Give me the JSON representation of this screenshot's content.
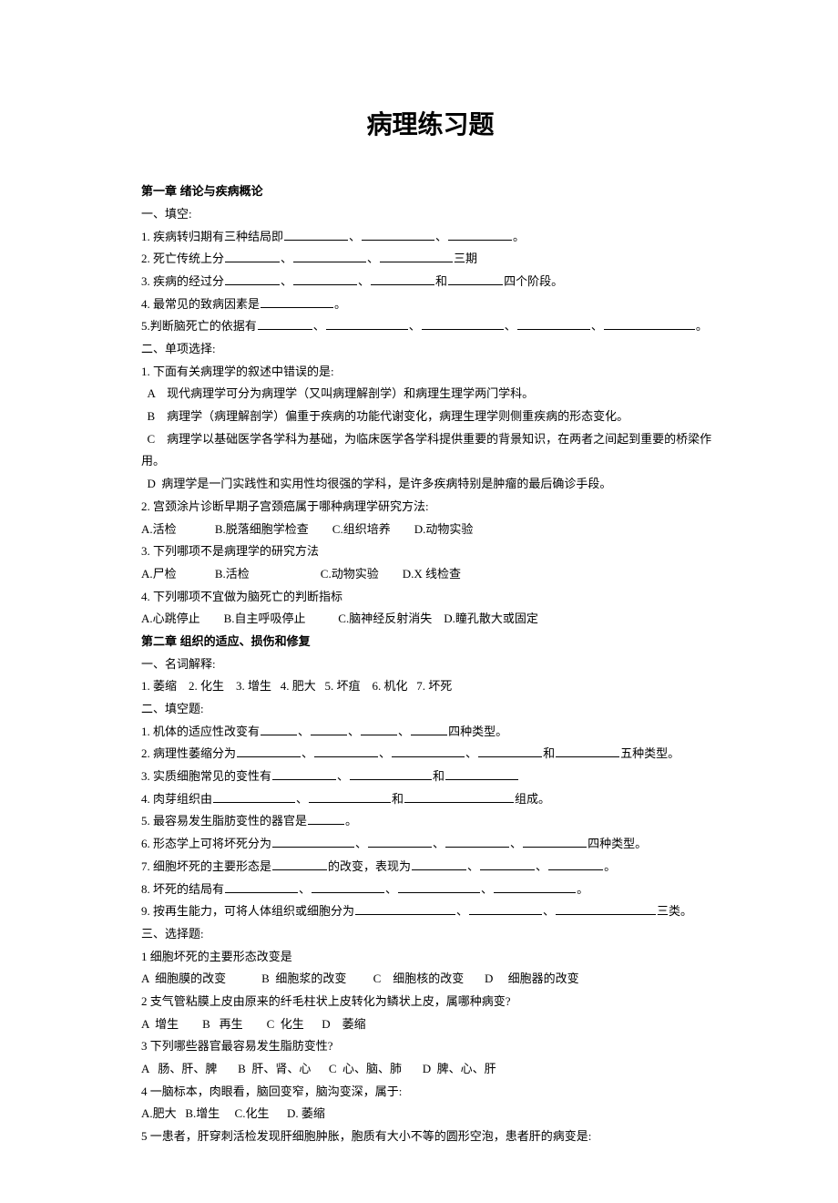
{
  "title": "病理练习题",
  "ch1": {
    "header": "第一章  绪论与疾病概论",
    "sec1_header": "一、填空:",
    "q1_a": "1. 疾病转归期有三种结局即",
    "q1_b": "、",
    "q1_c": "、",
    "q1_d": "。",
    "q2_a": "2. 死亡传统上分",
    "q2_b": "、",
    "q2_c": "、",
    "q2_d": "三期",
    "q3_a": "3. 疾病的经过分",
    "q3_b": "、",
    "q3_c": "、",
    "q3_d": "和",
    "q3_e": "四个阶段。",
    "q4_a": "4. 最常见的致病因素是",
    "q4_b": "。",
    "q5_a": "5.判断脑死亡的依据有",
    "q5_b": "、",
    "q5_c": "、",
    "q5_d": "、",
    "q5_e": "、",
    "q5_f": "。",
    "sec2_header": "二、单项选择:",
    "mc1": "1. 下面有关病理学的叙述中错误的是:",
    "mc1a": "  A    现代病理学可分为病理学（又叫病理解剖学）和病理生理学两门学科。",
    "mc1b": "  B    病理学（病理解剖学）偏重于疾病的功能代谢变化，病理生理学则侧重疾病的形态变化。",
    "mc1c": "  C    病理学以基础医学各学科为基础，为临床医学各学科提供重要的背景知识，在两者之间起到重要的桥梁作用。",
    "mc1d": "  D  病理学是一门实践性和实用性均很强的学科，是许多疾病特别是肿瘤的最后确诊手段。",
    "mc2": "2. 宫颈涂片诊断早期子宫颈癌属于哪种病理学研究方法:",
    "mc2o": "A.活检             B.脱落细胞学检查        C.组织培养        D.动物实验",
    "mc3": "3. 下列哪项不是病理学的研究方法",
    "mc3o": "A.尸检             B.活检                        C.动物实验        D.X 线检查",
    "mc4": "4. 下列哪项不宜做为脑死亡的判断指标",
    "mc4o": "A.心跳停止        B.自主呼吸停止           C.脑神经反射消失    D.瞳孔散大或固定"
  },
  "ch2": {
    "header": "第二章  组织的适应、损伤和修复",
    "sec1_header": "一、名词解释:",
    "terms": "1. 萎缩    2. 化生    3. 增生   4. 肥大   5. 坏疽    6. 机化   7. 坏死",
    "sec2_header": "二、填空题:",
    "f1_a": "1. 机体的适应性改变有",
    "f1_b": "、",
    "f1_c": "、",
    "f1_d": "、",
    "f1_e": "四种类型。",
    "f2_a": "2. 病理性萎缩分为",
    "f2_b": "、",
    "f2_c": "、",
    "f2_d": "、",
    "f2_e": "和",
    "f2_f": "五种类型。",
    "f3_a": "3. 实质细胞常见的变性有",
    "f3_b": "、",
    "f3_c": "和",
    "f4_a": "4. 肉芽组织由",
    "f4_b": "、",
    "f4_c": "和",
    "f4_d": "组成。",
    "f5_a": "5. 最容易发生脂肪变性的器官是",
    "f5_b": "。",
    "f6_a": "6. 形态学上可将坏死分为",
    "f6_b": "、",
    "f6_c": "、",
    "f6_d": "、",
    "f6_e": "四种类型。",
    "f7_a": "7. 细胞坏死的主要形态是",
    "f7_b": "的改变，表现为",
    "f7_c": "、",
    "f7_d": "、",
    "f7_e": "。",
    "f8_a": "8. 坏死的结局有",
    "f8_b": "、",
    "f8_c": "、",
    "f8_d": "、",
    "f8_e": "。",
    "f9_a": "9. 按再生能力，可将人体组织或细胞分为",
    "f9_b": "、",
    "f9_c": "、",
    "f9_d": "三类。",
    "sec3_header": "三、选择题:",
    "m1": "1 细胞坏死的主要形态改变是",
    "m1o": "A  细胞膜的改变            B  细胞浆的改变         C    细胞核的改变       D     细胞器的改变",
    "m2": "2 支气管粘膜上皮由原来的纤毛柱状上皮转化为鳞状上皮，属哪种病变?",
    "m2o": "A  增生        B   再生        C  化生      D    萎缩",
    "m3": "3 下列哪些器官最容易发生脂肪变性?",
    "m3o": "A   肠、肝、脾       B  肝、肾、心      C  心、脑、肺       D  脾、心、肝",
    "m4": "4 一脑标本，肉眼看，脑回变窄，脑沟变深，属于:",
    "m4o": "A.肥大   B.增生     C.化生      D. 萎缩",
    "m5": "5 一患者，肝穿刺活检发现肝细胞肿胀，胞质有大小不等的圆形空泡，患者肝的病变是:"
  }
}
